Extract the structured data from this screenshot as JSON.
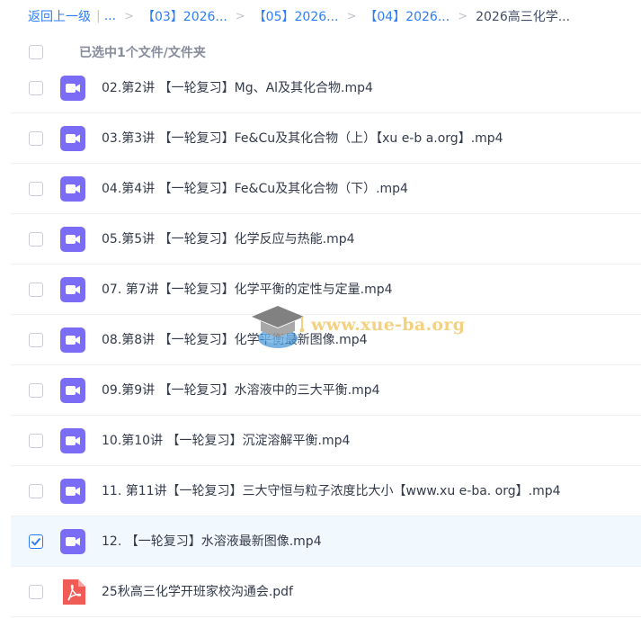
{
  "breadcrumb": {
    "back_label": "返回上一级",
    "separator": "|",
    "ellipsis": "...",
    "arrow": ">",
    "items": [
      "【03】2026...",
      "【05】2026...",
      "【04】2026..."
    ],
    "current": "2026高三化学..."
  },
  "selection": {
    "status_text": "已选中1个文件/文件夹"
  },
  "files": [
    {
      "name": "02.第2讲 【一轮复习】Mg、Al及其化合物.mp4",
      "type": "video",
      "checked": false
    },
    {
      "name": "03.第3讲 【一轮复习】Fe&Cu及其化合物（上）【xu e-b a.org】.mp4",
      "type": "video",
      "checked": false
    },
    {
      "name": "04.第4讲 【一轮复习】Fe&Cu及其化合物（下）.mp4",
      "type": "video",
      "checked": false
    },
    {
      "name": "05.第5讲 【一轮复习】化学反应与热能.mp4",
      "type": "video",
      "checked": false
    },
    {
      "name": "07. 第7讲【一轮复习】化学平衡的定性与定量.mp4",
      "type": "video",
      "checked": false
    },
    {
      "name": "08.第8讲 【一轮复习】化学平衡最新图像.mp4",
      "type": "video",
      "checked": false
    },
    {
      "name": "09.第9讲 【一轮复习】水溶液中的三大平衡.mp4",
      "type": "video",
      "checked": false
    },
    {
      "name": "10.第10讲 【一轮复习】沉淀溶解平衡.mp4",
      "type": "video",
      "checked": false
    },
    {
      "name": "11. 第11讲【一轮复习】三大守恒与粒子浓度比大小【www.xu e-ba. org】.mp4",
      "type": "video",
      "checked": false
    },
    {
      "name": "12. 【一轮复习】水溶液最新图像.mp4",
      "type": "video",
      "checked": true
    },
    {
      "name": "25秋高三化学开班家校沟通会.pdf",
      "type": "pdf",
      "checked": false
    }
  ],
  "watermark": {
    "text": "www.xue-ba.org"
  },
  "colors": {
    "accent": "#2c7ef8",
    "video_icon": "#7b6cf6",
    "pdf_icon": "#f05b55",
    "selected_row": "#f1f9ff",
    "watermark": "#f2c96a"
  },
  "icons": {
    "video": "video-file-icon",
    "pdf": "pdf-file-icon"
  }
}
